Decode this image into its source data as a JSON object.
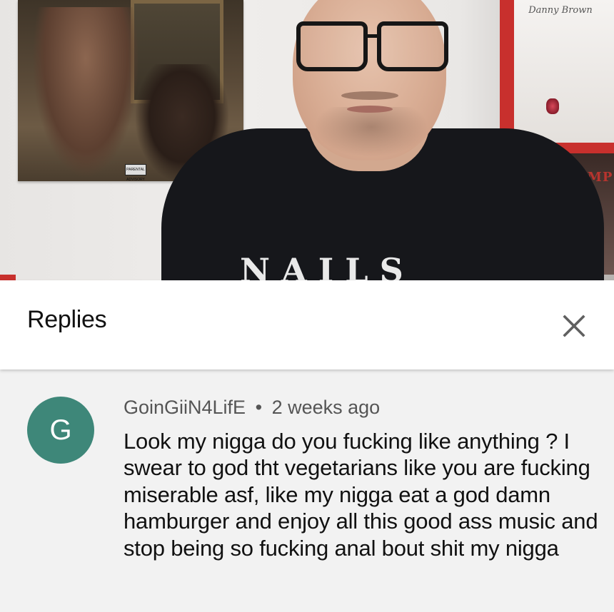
{
  "video": {
    "shirt_text": "NAILS",
    "poster_left_badge": "PARENTAL ADVISORY",
    "poster_right_title": "Danny Brown",
    "poster_right_lower_text": "RAMP"
  },
  "replies": {
    "title": "Replies",
    "close_icon": "close-icon"
  },
  "comment": {
    "avatar_letter": "G",
    "avatar_color": "#3e8779",
    "author": "GoinGiiN4LifE",
    "separator": "•",
    "timestamp": "2 weeks ago",
    "text": "Look my nigga do you fucking like anything ? I swear to god tht vegetarians like you are fucking miserable asf, like my nigga eat a god damn hamburger and enjoy all this good ass music and stop being so fucking anal bout shit my nigga"
  }
}
